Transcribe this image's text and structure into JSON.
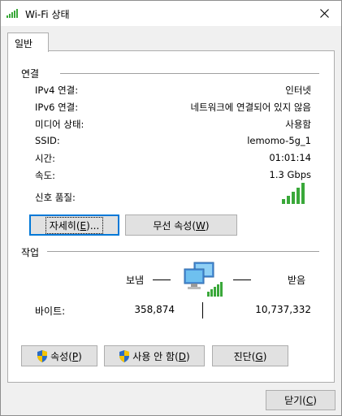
{
  "window": {
    "title": "Wi-Fi 상태",
    "icon": "wifi-signal-icon"
  },
  "tabs": [
    {
      "label": "일반"
    }
  ],
  "connection": {
    "header": "연결",
    "rows": [
      {
        "label": "IPv4 연결:",
        "value": "인터넷"
      },
      {
        "label": "IPv6 연결:",
        "value": "네트워크에 연결되어 있지 않음"
      },
      {
        "label": "미디어 상태:",
        "value": "사용함"
      },
      {
        "label": "SSID:",
        "value": "lemomo-5g_1"
      },
      {
        "label": "시간:",
        "value": "01:01:14"
      },
      {
        "label": "속도:",
        "value": "1.3 Gbps"
      }
    ],
    "signal_label": "신호 품질:",
    "signal_bars_lit": 5,
    "signal_bars_total": 5,
    "details_btn": {
      "text": "자세히",
      "key": "E",
      "suffix": "..."
    },
    "wireless_btn": {
      "text": "무선 속성",
      "key": "W"
    }
  },
  "activity": {
    "header": "작업",
    "sent_label": "보냄",
    "received_label": "받음",
    "bytes_label": "바이트:",
    "bytes_sent": "358,874",
    "bytes_received": "10,737,332"
  },
  "actions": {
    "properties_btn": {
      "text": "속성",
      "key": "P"
    },
    "disable_btn": {
      "text": "사용 안 함",
      "key": "D"
    },
    "diagnose_btn": {
      "text": "진단",
      "key": "G"
    }
  },
  "footer": {
    "close_btn": {
      "text": "닫기",
      "key": "C"
    }
  },
  "colors": {
    "signal_green": "#3aa83a",
    "focus_blue": "#0078d7",
    "panel_border": "#adadad"
  }
}
